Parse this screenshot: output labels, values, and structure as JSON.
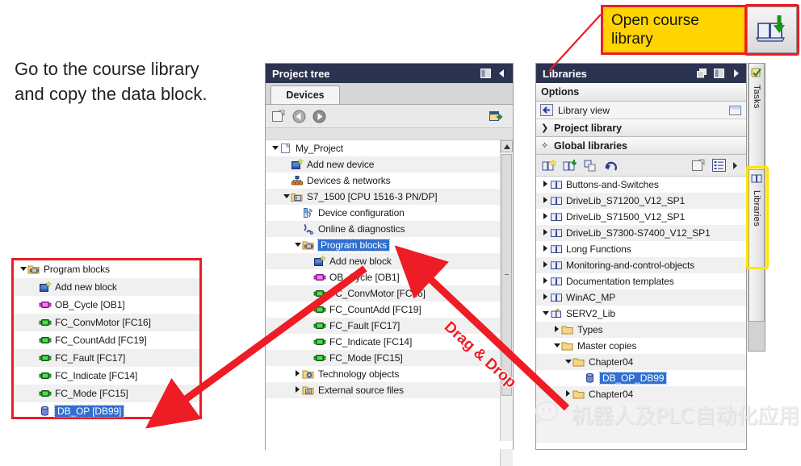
{
  "instruction": {
    "line1": "Go to the course library",
    "line2": "and copy the data block."
  },
  "callout": {
    "line1": "Open course",
    "line2": "library",
    "button_icon": "open-library-icon"
  },
  "drag_label": "Drag & Drop",
  "project_tree": {
    "title": "Project tree",
    "header_icons": [
      "split-view-icon",
      "collapse-left-icon"
    ],
    "tab": "Devices",
    "toolbar_icons": [
      "new-window-icon",
      "back-icon",
      "forward-icon",
      "snapshot-icon"
    ],
    "items": [
      {
        "label": "My_Project",
        "indent": 0,
        "arrow": "down",
        "icon": "project-icon"
      },
      {
        "label": "Add new device",
        "indent": 1,
        "arrow": "",
        "icon": "add-device-icon"
      },
      {
        "label": "Devices & networks",
        "indent": 1,
        "arrow": "",
        "icon": "devices-networks-icon"
      },
      {
        "label": "S7_1500 [CPU 1516-3 PN/DP]",
        "indent": 1,
        "arrow": "down",
        "icon": "plc-folder-icon"
      },
      {
        "label": "Device configuration",
        "indent": 2,
        "arrow": "",
        "icon": "device-config-icon"
      },
      {
        "label": "Online & diagnostics",
        "indent": 2,
        "arrow": "",
        "icon": "online-diagnostics-icon"
      },
      {
        "label": "Program blocks",
        "indent": 2,
        "arrow": "down",
        "icon": "program-blocks-folder-icon",
        "selected": true
      },
      {
        "label": "Add new block",
        "indent": 3,
        "arrow": "",
        "icon": "add-block-icon"
      },
      {
        "label": "OB_Cycle [OB1]",
        "indent": 3,
        "arrow": "",
        "icon": "ob-block-icon"
      },
      {
        "label": "FC_ConvMotor [FC16]",
        "indent": 3,
        "arrow": "",
        "icon": "fc-block-icon"
      },
      {
        "label": "FC_CountAdd [FC19]",
        "indent": 3,
        "arrow": "",
        "icon": "fc-block-icon"
      },
      {
        "label": "FC_Fault [FC17]",
        "indent": 3,
        "arrow": "",
        "icon": "fc-block-icon"
      },
      {
        "label": "FC_Indicate [FC14]",
        "indent": 3,
        "arrow": "",
        "icon": "fc-block-icon"
      },
      {
        "label": "FC_Mode [FC15]",
        "indent": 3,
        "arrow": "",
        "icon": "fc-block-icon"
      },
      {
        "label": "Technology objects",
        "indent": 2,
        "arrow": "right",
        "icon": "technology-objects-icon"
      },
      {
        "label": "External source files",
        "indent": 2,
        "arrow": "right",
        "icon": "external-source-icon"
      }
    ]
  },
  "libraries": {
    "title": "Libraries",
    "header_icons": [
      "float-icon",
      "split-view-icon",
      "collapse-right-icon"
    ],
    "options_label": "Options",
    "library_view_label": "Library view",
    "project_library_label": "Project library",
    "global_libraries_label": "Global libraries",
    "toolbar_icons": [
      "new-library-icon",
      "open-library-icon",
      "copy-library-icon",
      "retrieve-library-icon",
      "new-object-icon",
      "list-view-icon"
    ],
    "items": [
      {
        "label": "Buttons-and-Switches",
        "indent": 0,
        "arrow": "right",
        "icon": "library-icon"
      },
      {
        "label": "DriveLib_S71200_V12_SP1",
        "indent": 0,
        "arrow": "right",
        "icon": "library-icon"
      },
      {
        "label": "DriveLib_S71500_V12_SP1",
        "indent": 0,
        "arrow": "right",
        "icon": "library-icon"
      },
      {
        "label": "DriveLib_S7300-S7400_V12_SP1",
        "indent": 0,
        "arrow": "right",
        "icon": "library-icon"
      },
      {
        "label": "Long Functions",
        "indent": 0,
        "arrow": "right",
        "icon": "library-icon"
      },
      {
        "label": "Monitoring-and-control-objects",
        "indent": 0,
        "arrow": "right",
        "icon": "library-icon"
      },
      {
        "label": "Documentation templates",
        "indent": 0,
        "arrow": "right",
        "icon": "library-icon"
      },
      {
        "label": "WinAC_MP",
        "indent": 0,
        "arrow": "right",
        "icon": "library-icon"
      },
      {
        "label": "SERV2_Lib",
        "indent": 0,
        "arrow": "down",
        "icon": "global-library-icon"
      },
      {
        "label": "Types",
        "indent": 1,
        "arrow": "right",
        "icon": "folder-icon"
      },
      {
        "label": "Master copies",
        "indent": 1,
        "arrow": "down",
        "icon": "folder-icon"
      },
      {
        "label": "Chapter04",
        "indent": 2,
        "arrow": "down",
        "icon": "folder-icon"
      },
      {
        "label": "DB_OP_DB99",
        "indent": 3,
        "arrow": "",
        "icon": "db-block-icon",
        "selected": true
      },
      {
        "label": "Chapter04",
        "indent": 2,
        "arrow": "right",
        "icon": "folder-icon"
      }
    ]
  },
  "right_tabs": [
    {
      "label": "Tasks",
      "icon": "tasks-icon",
      "highlighted": false
    },
    {
      "label": "Libraries",
      "icon": "libraries-icon",
      "highlighted": true
    }
  ],
  "inset": {
    "items": [
      {
        "label": "Program blocks",
        "indent": 0,
        "arrow": "down",
        "icon": "program-blocks-folder-icon"
      },
      {
        "label": "Add new block",
        "indent": 1,
        "arrow": "",
        "icon": "add-block-icon"
      },
      {
        "label": "OB_Cycle [OB1]",
        "indent": 1,
        "arrow": "",
        "icon": "ob-block-icon"
      },
      {
        "label": "FC_ConvMotor [FC16]",
        "indent": 1,
        "arrow": "",
        "icon": "fc-block-icon"
      },
      {
        "label": "FC_CountAdd [FC19]",
        "indent": 1,
        "arrow": "",
        "icon": "fc-block-icon"
      },
      {
        "label": "FC_Fault [FC17]",
        "indent": 1,
        "arrow": "",
        "icon": "fc-block-icon"
      },
      {
        "label": "FC_Indicate [FC14]",
        "indent": 1,
        "arrow": "",
        "icon": "fc-block-icon"
      },
      {
        "label": "FC_Mode [FC15]",
        "indent": 1,
        "arrow": "",
        "icon": "fc-block-icon"
      },
      {
        "label": "DB_OP [DB99]",
        "indent": 1,
        "arrow": "",
        "icon": "db-block-icon",
        "selected": true
      }
    ]
  },
  "watermark": {
    "text": "机器人及PLC自动化应用",
    "icon": "wechat-icon"
  },
  "colors": {
    "panel_header": "#2b3350",
    "annotation_red": "#ee1c25",
    "highlight_yellow": "#ffe400",
    "callout_yellow": "#ffd400",
    "selection_blue": "#2f6fd0"
  }
}
